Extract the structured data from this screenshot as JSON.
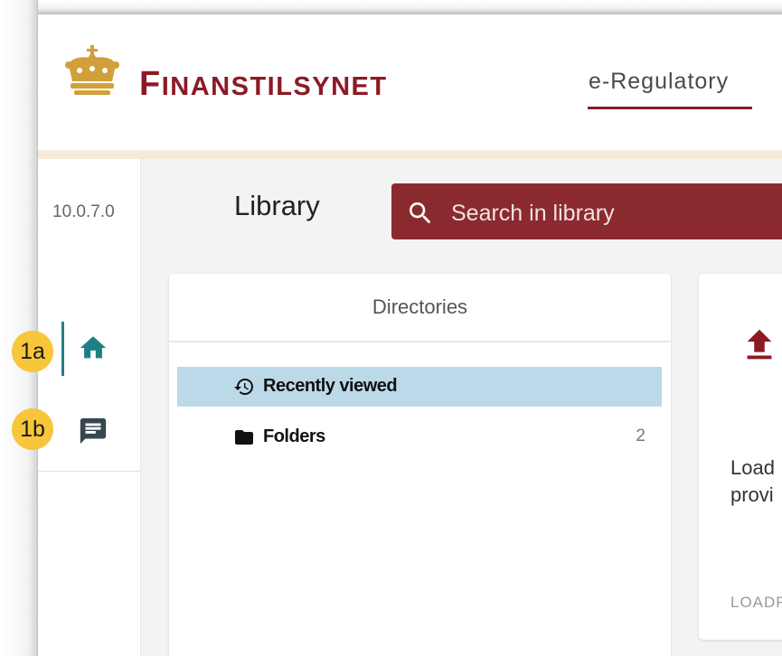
{
  "header": {
    "brand_first": "F",
    "brand_rest": "INANSTILSYNET",
    "nav_tab": "e-Regulatory"
  },
  "sidebar": {
    "version": "10.0.7.0",
    "items": [
      {
        "name": "home",
        "icon": "home-icon",
        "active": true
      },
      {
        "name": "messages",
        "icon": "message-icon",
        "active": false
      }
    ]
  },
  "main": {
    "title": "Library",
    "search": {
      "placeholder": "Search in library"
    }
  },
  "directories": {
    "title": "Directories",
    "items": [
      {
        "label": "Recently viewed",
        "icon": "history-icon",
        "selected": true,
        "count": ""
      },
      {
        "label": "Folders",
        "icon": "folder-icon",
        "selected": false,
        "count": "2"
      }
    ]
  },
  "upload_card": {
    "text_line1": "Load",
    "text_line2": "provi",
    "link": "LOADF"
  },
  "annotations": [
    "1a",
    "1b"
  ],
  "colors": {
    "brand": "#8b1a25",
    "search_bg": "#8b2a2e",
    "selection": "#bcd9ea",
    "accent_teal": "#1f7f86",
    "header_band": "#f7eadc",
    "badge": "#f7c63a",
    "crown_gold": "#d2a03a"
  }
}
